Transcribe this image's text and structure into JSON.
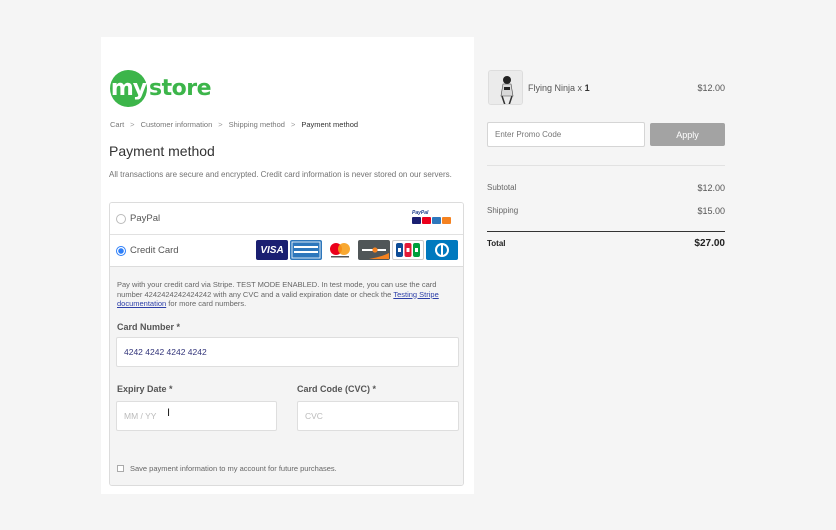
{
  "brand": {
    "logo_circle": "my",
    "logo_text": "store",
    "color": "#3cb54a"
  },
  "breadcrumb": {
    "items": [
      "Cart",
      "Customer information",
      "Shipping method",
      "Payment method"
    ],
    "separator": ">"
  },
  "checkout": {
    "title": "Payment method",
    "secure_note": "All transactions are secure and encrypted. Credit card information is never stored on our servers.",
    "methods": [
      {
        "label": "PayPal",
        "selected": false
      },
      {
        "label": "Credit Card",
        "selected": true
      }
    ],
    "paypal_logo_text": "PayPal",
    "card_brands": [
      "VISA",
      "AMERICAN EXPRESS",
      "MasterCard",
      "DISCOVER",
      "JCB",
      "Diners Club"
    ],
    "card_brand_icons": [
      "visa-logo-icon",
      "amex-logo-icon",
      "mastercard-logo-icon",
      "discover-logo-icon",
      "jcb-logo-icon",
      "diners-logo-icon"
    ]
  },
  "stripe": {
    "info_prefix": "Pay with your credit card via Stripe. TEST MODE ENABLED. In test mode, you can use the card number 4242424242424242 with any CVC and a valid expiration date or check the",
    "doc_link": "Testing Stripe documentation",
    "info_suffix": "for more card numbers."
  },
  "card_form": {
    "card_number_label": "Card Number *",
    "card_number_value": "4242 4242 4242 4242",
    "expiry_label": "Expiry Date *",
    "expiry_placeholder": "MM / YY",
    "cvc_label": "Card Code (CVC) *",
    "cvc_placeholder": "CVC",
    "save_label": "Save payment information to my account for future purchases.",
    "save_checked": false
  },
  "order": {
    "product_name": "Flying Ninja",
    "quantity_text": "x",
    "quantity": "1",
    "product_price": "$12.00",
    "promo_placeholder": "Enter Promo Code",
    "apply_label": "Apply",
    "subtotal_label": "Subtotal",
    "subtotal_value": "$12.00",
    "shipping_label": "Shipping",
    "shipping_value": "$15.00",
    "total_label": "Total",
    "total_value": "$27.00"
  }
}
